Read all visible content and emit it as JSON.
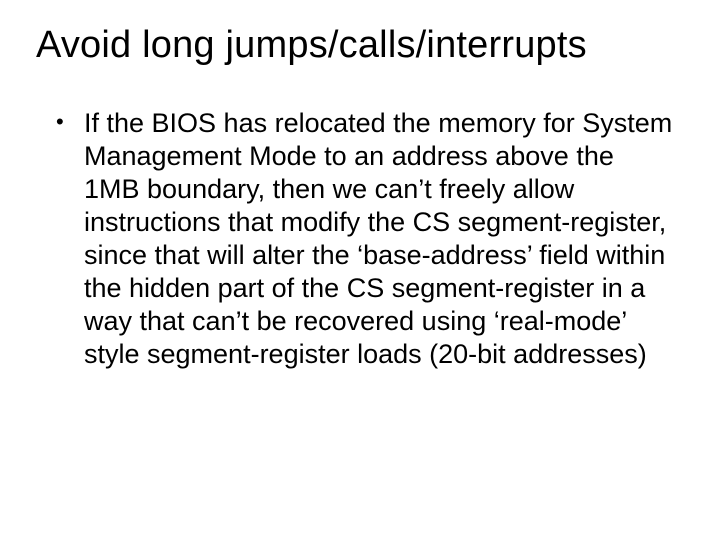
{
  "slide": {
    "title": "Avoid long jumps/calls/interrupts",
    "bullets": [
      "If the BIOS has relocated the memory for System Management Mode to an address above the 1MB boundary, then we can’t freely allow instructions that modify the CS segment-register, since that will alter the ‘base-address’ field within the hidden part of the CS segment-register in a way that can’t be recovered using ‘real-mode’ style segment-register loads (20-bit addresses)"
    ]
  }
}
